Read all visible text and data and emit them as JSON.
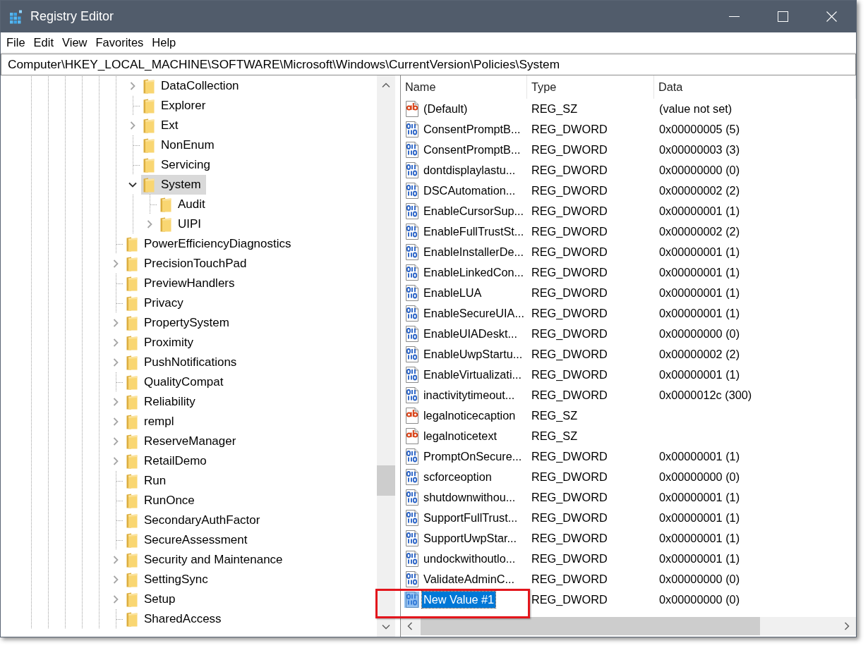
{
  "window": {
    "title": "Registry Editor"
  },
  "menu": [
    "File",
    "Edit",
    "View",
    "Favorites",
    "Help"
  ],
  "address": "Computer\\HKEY_LOCAL_MACHINE\\SOFTWARE\\Microsoft\\Windows\\CurrentVersion\\Policies\\System",
  "tree": {
    "items": [
      {
        "children": [
          {
            "kind": "branch",
            "label": "DataCollection",
            "expanded": false,
            "selected": false
          },
          {
            "kind": "leaf",
            "label": "Explorer",
            "selected": false
          },
          {
            "kind": "branch",
            "label": "Ext",
            "expanded": false,
            "selected": false
          },
          {
            "kind": "leaf",
            "label": "NonEnum",
            "selected": false
          },
          {
            "kind": "leaf",
            "label": "Servicing",
            "selected": false
          },
          {
            "kind": "branch",
            "label": "System",
            "expanded": true,
            "selected": true,
            "children": [
              {
                "kind": "leaf",
                "label": "Audit",
                "selected": false
              },
              {
                "kind": "branch",
                "label": "UIPI",
                "expanded": false,
                "selected": false
              }
            ]
          }
        ]
      },
      {
        "kind": "leaf",
        "label": "PowerEfficiencyDiagnostics",
        "selected": false
      },
      {
        "kind": "branch",
        "label": "PrecisionTouchPad",
        "expanded": false,
        "selected": false
      },
      {
        "kind": "leaf",
        "label": "PreviewHandlers",
        "selected": false
      },
      {
        "kind": "leaf",
        "label": "Privacy",
        "selected": false
      },
      {
        "kind": "branch",
        "label": "PropertySystem",
        "expanded": false,
        "selected": false
      },
      {
        "kind": "branch",
        "label": "Proximity",
        "expanded": false,
        "selected": false
      },
      {
        "kind": "branch",
        "label": "PushNotifications",
        "expanded": false,
        "selected": false
      },
      {
        "kind": "leaf",
        "label": "QualityCompat",
        "selected": false
      },
      {
        "kind": "branch",
        "label": "Reliability",
        "expanded": false,
        "selected": false
      },
      {
        "kind": "branch",
        "label": "rempl",
        "expanded": false,
        "selected": false
      },
      {
        "kind": "branch",
        "label": "ReserveManager",
        "expanded": false,
        "selected": false
      },
      {
        "kind": "branch",
        "label": "RetailDemo",
        "expanded": false,
        "selected": false
      },
      {
        "kind": "leaf",
        "label": "Run",
        "selected": false
      },
      {
        "kind": "leaf",
        "label": "RunOnce",
        "selected": false
      },
      {
        "kind": "leaf",
        "label": "SecondaryAuthFactor",
        "selected": false
      },
      {
        "kind": "leaf",
        "label": "SecureAssessment",
        "selected": false
      },
      {
        "kind": "branch",
        "label": "Security and Maintenance",
        "expanded": false,
        "selected": false
      },
      {
        "kind": "branch",
        "label": "SettingSync",
        "expanded": false,
        "selected": false
      },
      {
        "kind": "branch",
        "label": "Setup",
        "expanded": false,
        "selected": false
      },
      {
        "kind": "leaf",
        "label": "SharedAccess",
        "selected": false
      }
    ]
  },
  "values": {
    "columns": [
      "Name",
      "Type",
      "Data"
    ],
    "rows": [
      {
        "kind": "string",
        "name": "(Default)",
        "type": "REG_SZ",
        "data": "(value not set)",
        "selected": false
      },
      {
        "kind": "dword",
        "name": "ConsentPromptB...",
        "type": "REG_DWORD",
        "data": "0x00000005 (5)",
        "selected": false
      },
      {
        "kind": "dword",
        "name": "ConsentPromptB...",
        "type": "REG_DWORD",
        "data": "0x00000003 (3)",
        "selected": false
      },
      {
        "kind": "dword",
        "name": "dontdisplaylastu...",
        "type": "REG_DWORD",
        "data": "0x00000000 (0)",
        "selected": false
      },
      {
        "kind": "dword",
        "name": "DSCAutomation...",
        "type": "REG_DWORD",
        "data": "0x00000002 (2)",
        "selected": false
      },
      {
        "kind": "dword",
        "name": "EnableCursorSup...",
        "type": "REG_DWORD",
        "data": "0x00000001 (1)",
        "selected": false
      },
      {
        "kind": "dword",
        "name": "EnableFullTrustSt...",
        "type": "REG_DWORD",
        "data": "0x00000002 (2)",
        "selected": false
      },
      {
        "kind": "dword",
        "name": "EnableInstallerDe...",
        "type": "REG_DWORD",
        "data": "0x00000001 (1)",
        "selected": false
      },
      {
        "kind": "dword",
        "name": "EnableLinkedCon...",
        "type": "REG_DWORD",
        "data": "0x00000001 (1)",
        "selected": false
      },
      {
        "kind": "dword",
        "name": "EnableLUA",
        "type": "REG_DWORD",
        "data": "0x00000001 (1)",
        "selected": false
      },
      {
        "kind": "dword",
        "name": "EnableSecureUIA...",
        "type": "REG_DWORD",
        "data": "0x00000001 (1)",
        "selected": false
      },
      {
        "kind": "dword",
        "name": "EnableUIADeskt...",
        "type": "REG_DWORD",
        "data": "0x00000000 (0)",
        "selected": false
      },
      {
        "kind": "dword",
        "name": "EnableUwpStartu...",
        "type": "REG_DWORD",
        "data": "0x00000002 (2)",
        "selected": false
      },
      {
        "kind": "dword",
        "name": "EnableVirtualizati...",
        "type": "REG_DWORD",
        "data": "0x00000001 (1)",
        "selected": false
      },
      {
        "kind": "dword",
        "name": "inactivitytimeout...",
        "type": "REG_DWORD",
        "data": "0x0000012c (300)",
        "selected": false
      },
      {
        "kind": "string",
        "name": "legalnoticecaption",
        "type": "REG_SZ",
        "selected": false
      },
      {
        "kind": "string",
        "name": "legalnoticetext",
        "type": "REG_SZ",
        "selected": false
      },
      {
        "kind": "dword",
        "name": "PromptOnSecure...",
        "type": "REG_DWORD",
        "data": "0x00000001 (1)",
        "selected": false
      },
      {
        "kind": "dword",
        "name": "scforceoption",
        "type": "REG_DWORD",
        "data": "0x00000000 (0)",
        "selected": false
      },
      {
        "kind": "dword",
        "name": "shutdownwithou...",
        "type": "REG_DWORD",
        "data": "0x00000001 (1)",
        "selected": false
      },
      {
        "kind": "dword",
        "name": "SupportFullTrust...",
        "type": "REG_DWORD",
        "data": "0x00000001 (1)",
        "selected": false
      },
      {
        "kind": "dword",
        "name": "SupportUwpStar...",
        "type": "REG_DWORD",
        "data": "0x00000001 (1)",
        "selected": false
      },
      {
        "kind": "dword",
        "name": "undockwithoutlo...",
        "type": "REG_DWORD",
        "data": "0x00000001 (1)",
        "selected": false
      },
      {
        "kind": "dword",
        "name": "ValidateAdminC...",
        "type": "REG_DWORD",
        "data": "0x00000000 (0)",
        "selected": false
      },
      {
        "kind": "dword",
        "name": "New Value #1",
        "type": "REG_DWORD",
        "data": "0x00000000 (0)",
        "selected": true
      }
    ]
  },
  "annotation": {
    "kind": "rectangle"
  }
}
